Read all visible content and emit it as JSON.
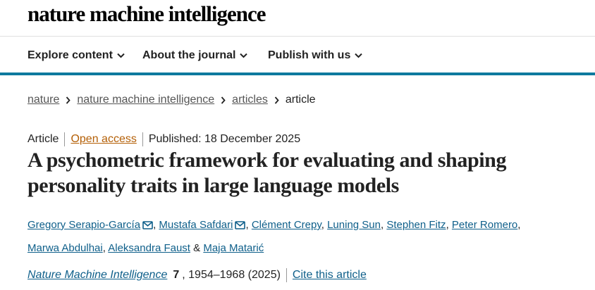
{
  "site": {
    "logo": "nature machine intelligence"
  },
  "nav": {
    "explore": "Explore content",
    "about": "About the journal",
    "publish": "Publish with us"
  },
  "breadcrumb": [
    "nature",
    "nature machine intelligence",
    "articles",
    "article"
  ],
  "article": {
    "type": "Article",
    "access": "Open access",
    "published": "Published: 18 December 2025",
    "title": "A psychometric framework for evaluating and shaping personality traits in large language models"
  },
  "authors": {
    "names": [
      "Gregory Serapio-García",
      "Mustafa Safdari",
      "Clément Crepy",
      "Luning Sun",
      "Stephen Fitz",
      "Peter Romero",
      "Marwa Abdulhai",
      "Aleksandra Faust",
      "Maja Matarić"
    ],
    "separator": ",",
    "conjunction": "&"
  },
  "citation": {
    "journal": "Nature Machine Intelligence",
    "volume": "7",
    "pages": ", 1954–1968 (2025)",
    "cite_label": "Cite this article"
  },
  "colors": {
    "accent": "#0e7a9e",
    "link": "#0e5f8a",
    "open_access": "#b45f06"
  },
  "icons": {
    "nav_dropdown": "chevron-down-icon",
    "breadcrumb_separator": "chevron-right-icon",
    "corresponding_author": "mail-icon"
  }
}
